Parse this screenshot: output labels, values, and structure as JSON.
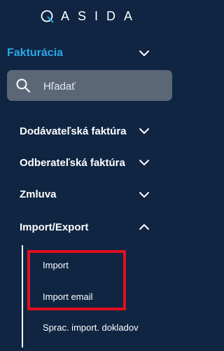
{
  "logo": {
    "letters": "ASIDA"
  },
  "section": {
    "title": "Fakturácia"
  },
  "search": {
    "placeholder": "Hľadať"
  },
  "nav": {
    "items": [
      {
        "label": "Dodávateľská faktúra"
      },
      {
        "label": "Odberateľská faktúra"
      },
      {
        "label": "Zmluva"
      },
      {
        "label": "Import/Export"
      }
    ]
  },
  "submenu": {
    "items": [
      {
        "label": "Import"
      },
      {
        "label": "Import email"
      },
      {
        "label": "Sprac. import. dokladov"
      }
    ]
  },
  "colors": {
    "background": "#0f2542",
    "accent": "#29a8e8",
    "search_bg": "#5b6677",
    "highlight": "#e0101e"
  }
}
